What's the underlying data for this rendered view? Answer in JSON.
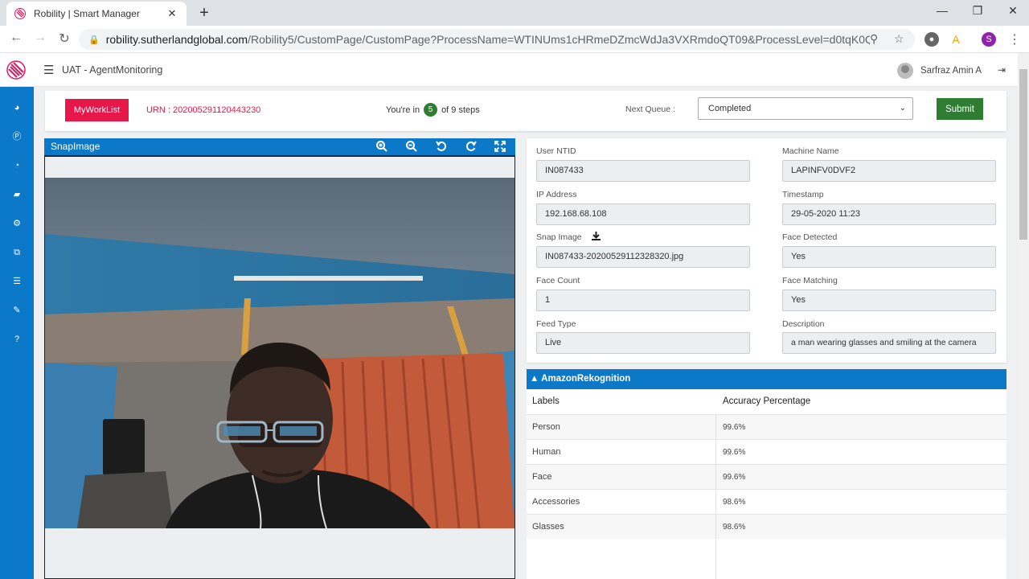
{
  "browser": {
    "tab_title": "Robility | Smart Manager",
    "url_host": "robility.sutherlandglobal.com",
    "url_rest": "/Robility5/CustomPage/CustomPage?ProcessName=WTINUms1cHRmeDZmcWdJa3VXRmdoQT09&ProcessLevel=d0tqK0QrM2hKT...",
    "profile_initial": "S"
  },
  "header": {
    "app_title": "UAT - AgentMonitoring",
    "user_name": "Sarfraz Amin A"
  },
  "actionbar": {
    "worklist_label": "MyWorkList",
    "urn": "URN : 202005291120443230",
    "steps_prefix": "You're in",
    "steps_current": "5",
    "steps_suffix": "of 9 steps",
    "next_queue_label": "Next Queue :",
    "next_queue_value": "Completed",
    "submit_label": "Submit"
  },
  "snap": {
    "title": "SnapImage"
  },
  "details": {
    "user_ntid_label": "User NTID",
    "user_ntid": "IN087433",
    "machine_name_label": "Machine Name",
    "machine_name": "LAPINFV0DVF2",
    "ip_label": "IP Address",
    "ip": "192.168.68.108",
    "timestamp_label": "Timestamp",
    "timestamp": "29-05-2020 11:23",
    "snap_image_label": "Snap Image",
    "snap_image": "IN087433-20200529112328320.jpg",
    "face_detected_label": "Face Detected",
    "face_detected": "Yes",
    "face_count_label": "Face Count",
    "face_count": "1",
    "face_matching_label": "Face Matching",
    "face_matching": "Yes",
    "feed_type_label": "Feed Type",
    "feed_type": "Live",
    "description_label": "Description",
    "description": "a man wearing glasses and smiling at the camera"
  },
  "rekognition": {
    "title": "▲ AmazonRekognition",
    "col_labels": "Labels",
    "col_accuracy": "Accuracy Percentage",
    "rows": [
      {
        "label": "Person",
        "accuracy": "99.6%"
      },
      {
        "label": "Human",
        "accuracy": "99.6%"
      },
      {
        "label": "Face",
        "accuracy": "99.6%"
      },
      {
        "label": "Accessories",
        "accuracy": "98.6%"
      },
      {
        "label": "Glasses",
        "accuracy": "98.6%"
      }
    ]
  },
  "colors": {
    "brand_blue": "#0b79c7",
    "accent_red": "#e8174a",
    "submit_green": "#2e7d32"
  }
}
